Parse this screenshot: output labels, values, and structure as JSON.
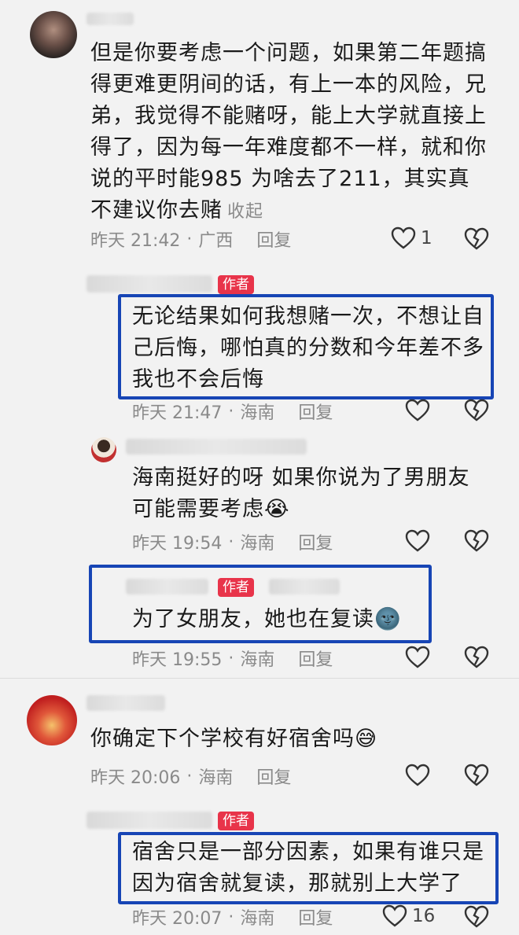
{
  "c1": {
    "text": "但是你要考虑一个问题，如果第二年题搞得更难更阴间的话，有上一本的风险，兄弟，我觉得不能赌呀，能上大学就直接上得了，因为每一年难度都不一样，就和你说的平时能985 为啥去了211，其实真不建议你去赌",
    "fold": "收起",
    "time": "昨天 21:42",
    "location": "广西",
    "reply": "回复",
    "likes": "1"
  },
  "r1": {
    "badge": "作者",
    "text": "无论结果如何我想赌一次，不想让自己后悔，哪怕真的分数和今年差不多我也不会后悔",
    "time": "昨天 21:47",
    "location": "海南",
    "reply": "回复"
  },
  "r2": {
    "text": "海南挺好的呀 如果你说为了男朋友 可能需要考虑",
    "emoji": "😭",
    "time": "昨天 19:54",
    "location": "海南",
    "reply": "回复"
  },
  "r3": {
    "badge": "作者",
    "text": "为了女朋友，她也在复读",
    "emoji": "🌚",
    "time": "昨天 19:55",
    "location": "海南",
    "reply": "回复"
  },
  "c2": {
    "text": "你确定下个学校有好宿舍吗",
    "emoji": "😅",
    "time": "昨天 20:06",
    "location": "海南",
    "reply": "回复"
  },
  "r4": {
    "badge": "作者",
    "text": "宿舍只是一部分因素，如果有谁只是因为宿舍就复读，那就别上大学了",
    "time": "昨天 20:07",
    "location": "海南",
    "reply": "回复",
    "likes": "16"
  },
  "icons": {
    "like": "heart-outline-icon",
    "dislike": "broken-heart-icon"
  },
  "colors": {
    "author_badge": "#e8344a",
    "highlight_box": "#1745b5"
  }
}
